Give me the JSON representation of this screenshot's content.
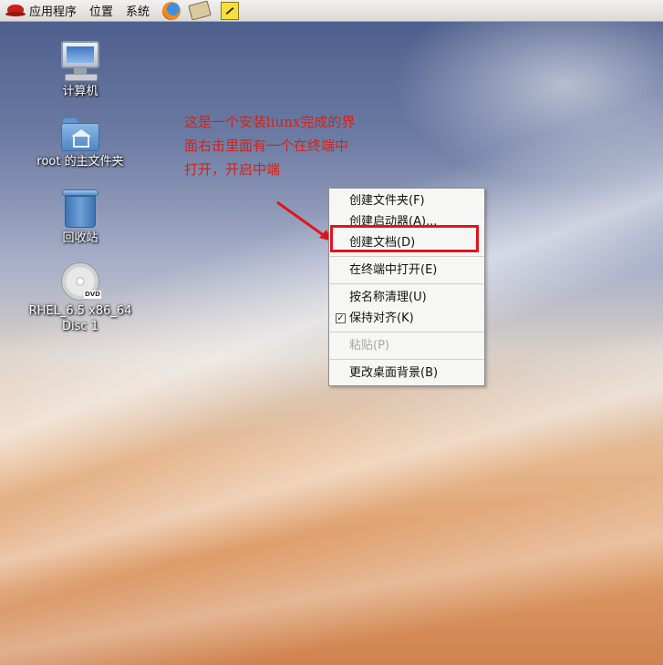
{
  "panel": {
    "menus": [
      "应用程序",
      "位置",
      "系统"
    ],
    "launchers": [
      "firefox-icon",
      "mail-icon",
      "notes-icon"
    ]
  },
  "desktop_icons": [
    {
      "label": "计算机",
      "icon": "computer-icon"
    },
    {
      "label": "root 的主文件夹",
      "icon": "home-folder-icon"
    },
    {
      "label": "回收站",
      "icon": "trash-icon"
    },
    {
      "label": "RHEL_6.5 x86_64 Disc 1",
      "icon": "dvd-icon",
      "badge": "DVD"
    }
  ],
  "annotation": {
    "text": "这是一个安装liunx完成的界面右击里面有一个在终端中打开，开启中端",
    "color": "#d0231b"
  },
  "context_menu": {
    "items": [
      {
        "label": "创建文件夹(F)",
        "enabled": true
      },
      {
        "label": "创建启动器(A)...",
        "enabled": true
      },
      {
        "label": "创建文档(D)",
        "enabled": true,
        "submenu": true,
        "highlighted": true
      },
      {
        "label": "在终端中打开(E)",
        "enabled": true
      },
      {
        "label": "按名称清理(U)",
        "enabled": true
      },
      {
        "label": "保持对齐(K)",
        "enabled": true,
        "checked": true
      },
      {
        "label": "粘贴(P)",
        "enabled": false
      },
      {
        "label": "更改桌面背景(B)",
        "enabled": true
      }
    ],
    "submenu_arrow": "›"
  },
  "colors": {
    "highlight_border": "#e0141d"
  }
}
